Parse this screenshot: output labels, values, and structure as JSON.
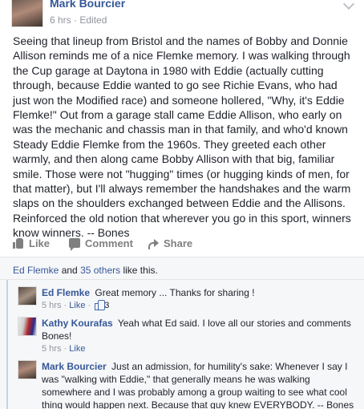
{
  "post": {
    "author": "Mark Bourcier",
    "time": "6 hrs",
    "edited": "Edited",
    "body": "Seeing that lineup from Bristol and the names of Bobby and Donnie Allison reminds me of a nice Flemke memory. I was walking through the Cup garage at Daytona in 1980 with Eddie (actually cutting through, because Eddie wanted to go see Richie Evans, who had just won the Modified race) and someone hollered, \"Why, it's Eddie Flemke!\" Out from a garage stall came Eddie Allison, who early on was the mechanic and chassis man in that family, and who'd known Steady Eddie Flemke from the 1960s. They greeted each other warmly, and then along came Bobby Allison with that big, familiar smile. Those were not \"hugging\" times (or hugging kinds of men, for that matter), but I'll always remember the handshakes and the warm slaps on the shoulders exchanged between Eddie and the Allisons. Reinforced the old notion that wherever you go in this sport, winners know winners. -- Bones"
  },
  "actions": {
    "like": "Like",
    "comment": "Comment",
    "share": "Share"
  },
  "likes": {
    "first_name": "Ed Flemke",
    "and": "and",
    "others": "35 others",
    "suffix": "like this."
  },
  "comments": [
    {
      "author": "Ed Flemke",
      "text": "Great memory ... Thanks for sharing !",
      "time": "5 hrs",
      "like_label": "Like",
      "like_count": "3"
    },
    {
      "author": "Kathy Kourafas",
      "text": "Yeah what Ed said. I love all our stories and comments Bones!",
      "time": "5 hrs",
      "like_label": "Like"
    },
    {
      "author": "Mark Bourcier",
      "text": "Just an admission, for humility's sake: Whenever I say I was \"walking with Eddie,\" that generally means he was walking somewhere and I was probably among a group waiting to see what cool thing would happen next. Because that guy knew EVERYBODY. -- Bones"
    }
  ],
  "separator": "·"
}
